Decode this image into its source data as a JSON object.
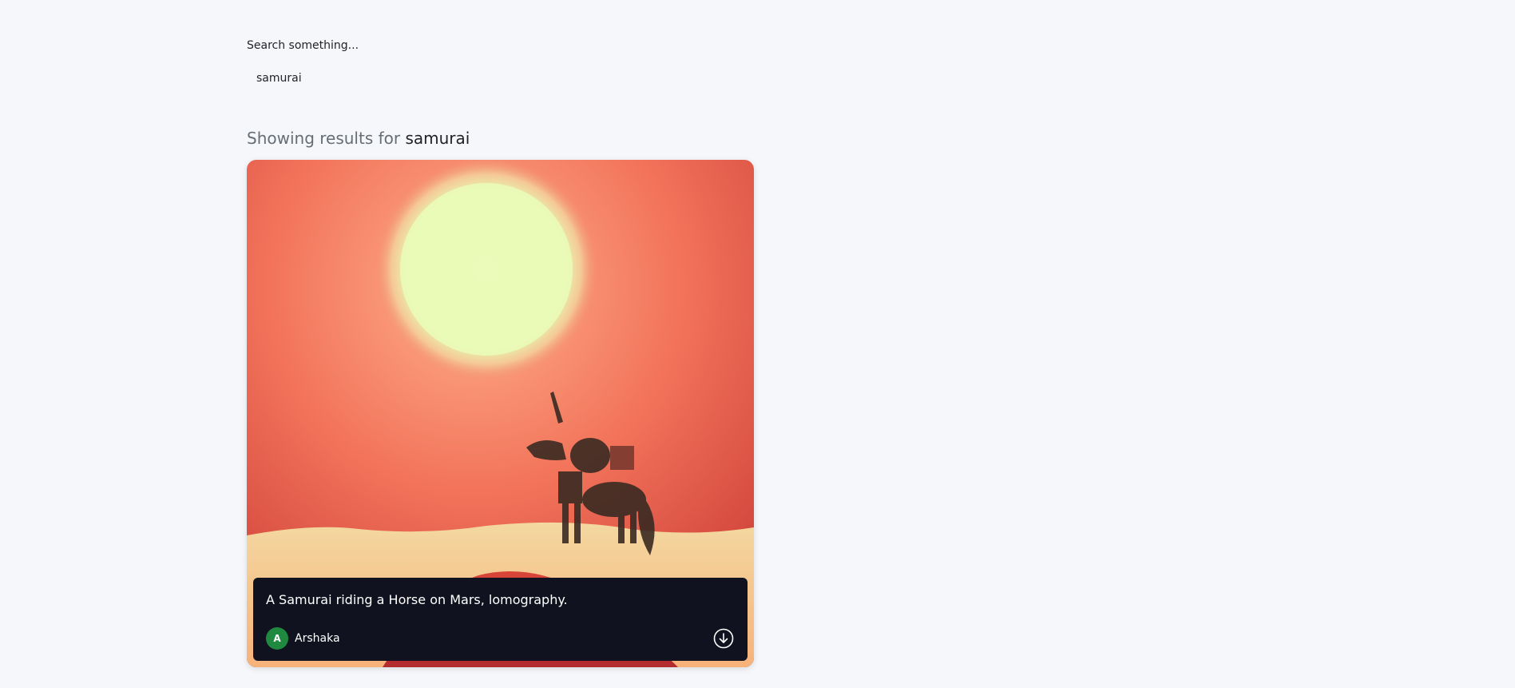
{
  "search": {
    "label": "Search something...",
    "value": "samurai"
  },
  "results": {
    "prefix": "Showing results for",
    "query": "samurai"
  },
  "card": {
    "prompt": "A Samurai riding a Horse on Mars, lomography.",
    "author_initial": "A",
    "author_name": "Arshaka",
    "avatar_color": "#1f8a3f",
    "download_icon": "download-icon"
  },
  "colors": {
    "background": "#f6f7fb",
    "overlay": "#10131f"
  }
}
